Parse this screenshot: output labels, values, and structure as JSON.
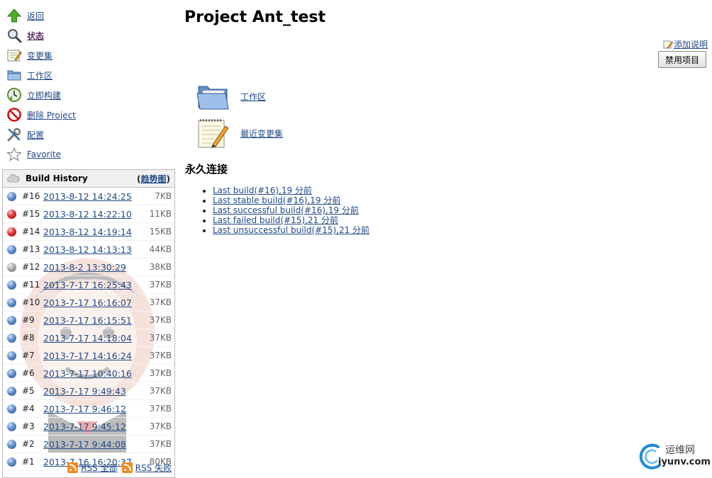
{
  "sidebar": {
    "items": [
      {
        "label": "返回",
        "icon": "up-arrow-icon"
      },
      {
        "label": "状态",
        "icon": "search-icon"
      },
      {
        "label": "变更集",
        "icon": "notepad-icon"
      },
      {
        "label": "工作区",
        "icon": "folder-icon"
      },
      {
        "label": "立即构建",
        "icon": "clock-icon"
      },
      {
        "label": "删除 Project",
        "icon": "no-entry-icon"
      },
      {
        "label": "配置",
        "icon": "tools-icon"
      },
      {
        "label": "Favorite",
        "icon": "star-icon"
      }
    ]
  },
  "history": {
    "title": "Build History",
    "trend_open": "(",
    "trend_label": "趋势图",
    "trend_close": ")",
    "rows": [
      {
        "num": "#16",
        "date": "2013-8-12 14:24:25",
        "size": "7KB",
        "status": "blue"
      },
      {
        "num": "#15",
        "date": "2013-8-12 14:22:10",
        "size": "11KB",
        "status": "red"
      },
      {
        "num": "#14",
        "date": "2013-8-12 14:19:14",
        "size": "15KB",
        "status": "red"
      },
      {
        "num": "#13",
        "date": "2013-8-12 14:13:13",
        "size": "44KB",
        "status": "blue"
      },
      {
        "num": "#12",
        "date": "2013-8-2 13:30:29",
        "size": "38KB",
        "status": "grey"
      },
      {
        "num": "#11",
        "date": "2013-7-17 16:25:43",
        "size": "37KB",
        "status": "blue"
      },
      {
        "num": "#10",
        "date": "2013-7-17 16:16:07",
        "size": "37KB",
        "status": "blue"
      },
      {
        "num": "#9",
        "date": "2013-7-17 16:15:51",
        "size": "37KB",
        "status": "blue"
      },
      {
        "num": "#8",
        "date": "2013-7-17 14:18:04",
        "size": "37KB",
        "status": "blue"
      },
      {
        "num": "#7",
        "date": "2013-7-17 14:16:24",
        "size": "37KB",
        "status": "blue"
      },
      {
        "num": "#6",
        "date": "2013-7-17 10:40:16",
        "size": "37KB",
        "status": "blue"
      },
      {
        "num": "#5",
        "date": "2013-7-17 9:49:43",
        "size": "37KB",
        "status": "blue"
      },
      {
        "num": "#4",
        "date": "2013-7-17 9:46:12",
        "size": "37KB",
        "status": "blue"
      },
      {
        "num": "#3",
        "date": "2013-7-17 9:45:12",
        "size": "37KB",
        "status": "blue"
      },
      {
        "num": "#2",
        "date": "2013-7-17 9:44:08",
        "size": "37KB",
        "status": "blue"
      },
      {
        "num": "#1",
        "date": "2013-7-16 16:20:37",
        "size": "80KB",
        "status": "blue"
      }
    ],
    "rss_all": "RSS 全部",
    "rss_failed": "RSS 失败"
  },
  "main": {
    "title": "Project Ant_test",
    "add_description": "添加说明",
    "disable_button": "禁用项目",
    "workspace_link": "工作区",
    "recent_changes_link": "最近变更集",
    "permalinks_heading": "永久连接",
    "permalinks": [
      "Last build(#16),19 分前",
      "Last stable build(#16),19 分前",
      "Last successful build(#16),19 分前",
      "Last failed build(#15),21 分前",
      "Last unsuccessful build(#15),21 分前"
    ]
  },
  "watermark": {
    "cn": "运维网",
    "domain": "iyunv.com"
  },
  "colors": {
    "link": "#204a87",
    "visited": "#5c3566",
    "success": "#3465a4",
    "failure": "#cc0000",
    "aborted": "#999999"
  }
}
